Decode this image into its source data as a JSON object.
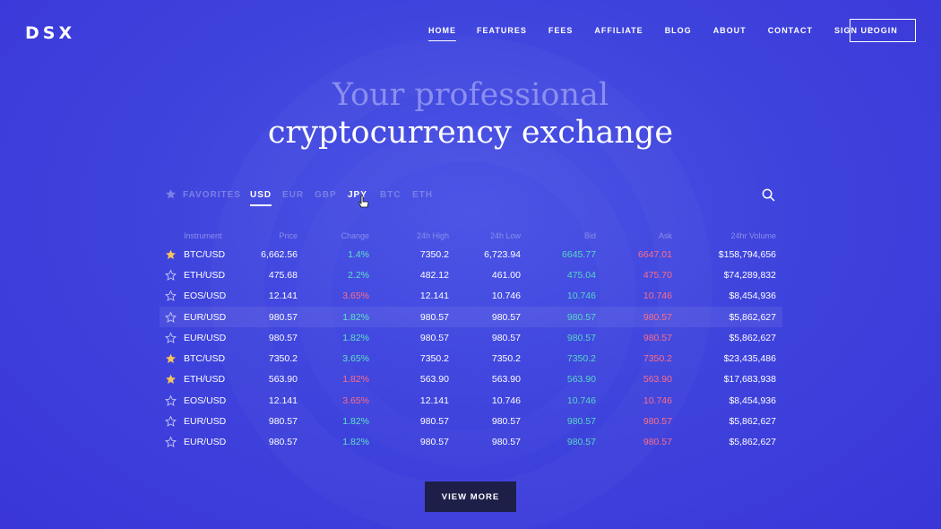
{
  "brand": {
    "logo": "DSX"
  },
  "nav": {
    "items": [
      "HOME",
      "FEATURES",
      "FEES",
      "AFFILIATE",
      "BLOG",
      "ABOUT",
      "CONTACT",
      "SIGN UP"
    ],
    "active": "HOME",
    "login_label": "LOGIN"
  },
  "hero": {
    "line1": "Your professional",
    "line2": "cryptocurrency exchange"
  },
  "tabs": {
    "favorites": "FAVORITES",
    "currencies": [
      "USD",
      "EUR",
      "GBP",
      "JPY",
      "BTC",
      "ETH"
    ],
    "active": "USD"
  },
  "table": {
    "headers": {
      "instrument": "Instrument",
      "price": "Price",
      "change": "Change",
      "high": "24h High",
      "low": "24h Low",
      "bid": "Bid",
      "ask": "Ask",
      "volume": "24hr Volume"
    },
    "rows": [
      {
        "fav": true,
        "instrument": "BTC/USD",
        "price": "6,662.56",
        "change": "1.4%",
        "dir": "up",
        "high": "7350.2",
        "low": "6,723.94",
        "bid": "6645.77",
        "ask": "6647.01",
        "volume": "$158,794,656"
      },
      {
        "fav": false,
        "instrument": "ETH/USD",
        "price": "475.68",
        "change": "2.2%",
        "dir": "up",
        "high": "482.12",
        "low": "461.00",
        "bid": "475.04",
        "ask": "475.70",
        "volume": "$74,289,832"
      },
      {
        "fav": false,
        "instrument": "EOS/USD",
        "price": "12.141",
        "change": "3.65%",
        "dir": "down",
        "high": "12.141",
        "low": "10.746",
        "bid": "10.746",
        "ask": "10.746",
        "volume": "$8,454,936"
      },
      {
        "fav": false,
        "instrument": "EUR/USD",
        "price": "980.57",
        "change": "1.82%",
        "dir": "up",
        "high": "980.57",
        "low": "980.57",
        "bid": "980.57",
        "ask": "980.57",
        "volume": "$5,862,627",
        "highlight": true
      },
      {
        "fav": false,
        "instrument": "EUR/USD",
        "price": "980.57",
        "change": "1.82%",
        "dir": "up",
        "high": "980.57",
        "low": "980.57",
        "bid": "980.57",
        "ask": "980.57",
        "volume": "$5,862,627"
      },
      {
        "fav": true,
        "instrument": "BTC/USD",
        "price": "7350.2",
        "change": "3.65%",
        "dir": "up",
        "high": "7350.2",
        "low": "7350.2",
        "bid": "7350.2",
        "ask": "7350.2",
        "volume": "$23,435,486"
      },
      {
        "fav": true,
        "instrument": "ETH/USD",
        "price": "563.90",
        "change": "1.82%",
        "dir": "down",
        "high": "563.90",
        "low": "563.90",
        "bid": "563.90",
        "ask": "563.90",
        "volume": "$17,683,938"
      },
      {
        "fav": false,
        "instrument": "EOS/USD",
        "price": "12.141",
        "change": "3.65%",
        "dir": "down",
        "high": "12.141",
        "low": "10.746",
        "bid": "10.746",
        "ask": "10.746",
        "volume": "$8,454,936"
      },
      {
        "fav": false,
        "instrument": "EUR/USD",
        "price": "980.57",
        "change": "1.82%",
        "dir": "up",
        "high": "980.57",
        "low": "980.57",
        "bid": "980.57",
        "ask": "980.57",
        "volume": "$5,862,627"
      },
      {
        "fav": false,
        "instrument": "EUR/USD",
        "price": "980.57",
        "change": "1.82%",
        "dir": "up",
        "high": "980.57",
        "low": "980.57",
        "bid": "980.57",
        "ask": "980.57",
        "volume": "$5,862,627"
      }
    ]
  },
  "cta": {
    "view_more": "VIEW MORE"
  },
  "colors": {
    "background": "#3f44dd",
    "star_filled": "#f5c35e",
    "positive": "#5fe0c6",
    "negative": "#ff6d86",
    "button_dark": "#1e1f49"
  }
}
